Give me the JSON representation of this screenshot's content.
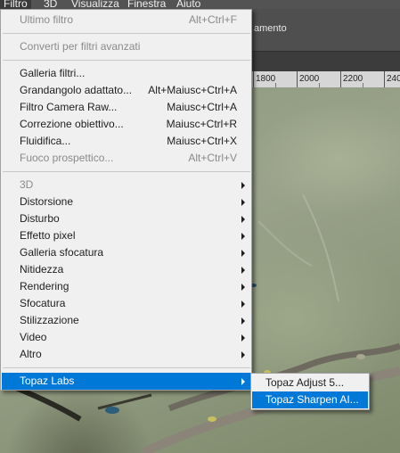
{
  "menubar": {
    "items": [
      "Filtro",
      "3D",
      "Visualizza",
      "Finestra",
      "Aiuto"
    ]
  },
  "options_bar": {
    "text": "amento"
  },
  "ruler": {
    "labels": [
      "1800",
      "2000",
      "2200",
      "240"
    ]
  },
  "menu": {
    "items": [
      {
        "label": "Ultimo filtro",
        "shortcut": "Alt+Ctrl+F",
        "disabled": true
      },
      {
        "label": "Converti per filtri avanzati",
        "shortcut": "",
        "disabled": true
      },
      {
        "label": "Galleria filtri...",
        "shortcut": ""
      },
      {
        "label": "Grandangolo adattato...",
        "shortcut": "Alt+Maiusc+Ctrl+A"
      },
      {
        "label": "Filtro Camera Raw...",
        "shortcut": "Maiusc+Ctrl+A"
      },
      {
        "label": "Correzione obiettivo...",
        "shortcut": "Maiusc+Ctrl+R"
      },
      {
        "label": "Fluidifica...",
        "shortcut": "Maiusc+Ctrl+X"
      },
      {
        "label": "Fuoco prospettico...",
        "shortcut": "Alt+Ctrl+V",
        "disabled": true
      },
      {
        "label": "3D",
        "disabled": true,
        "submenu": true
      },
      {
        "label": "Distorsione",
        "submenu": true
      },
      {
        "label": "Disturbo",
        "submenu": true
      },
      {
        "label": "Effetto pixel",
        "submenu": true
      },
      {
        "label": "Galleria sfocatura",
        "submenu": true
      },
      {
        "label": "Nitidezza",
        "submenu": true
      },
      {
        "label": "Rendering",
        "submenu": true
      },
      {
        "label": "Sfocatura",
        "submenu": true
      },
      {
        "label": "Stilizzazione",
        "submenu": true
      },
      {
        "label": "Video",
        "submenu": true
      },
      {
        "label": "Altro",
        "submenu": true
      },
      {
        "label": "Topaz Labs",
        "submenu": true,
        "selected": true
      }
    ]
  },
  "submenu": {
    "items": [
      {
        "label": "Topaz Adjust 5..."
      },
      {
        "label": "Topaz Sharpen AI...",
        "selected": true
      }
    ]
  }
}
